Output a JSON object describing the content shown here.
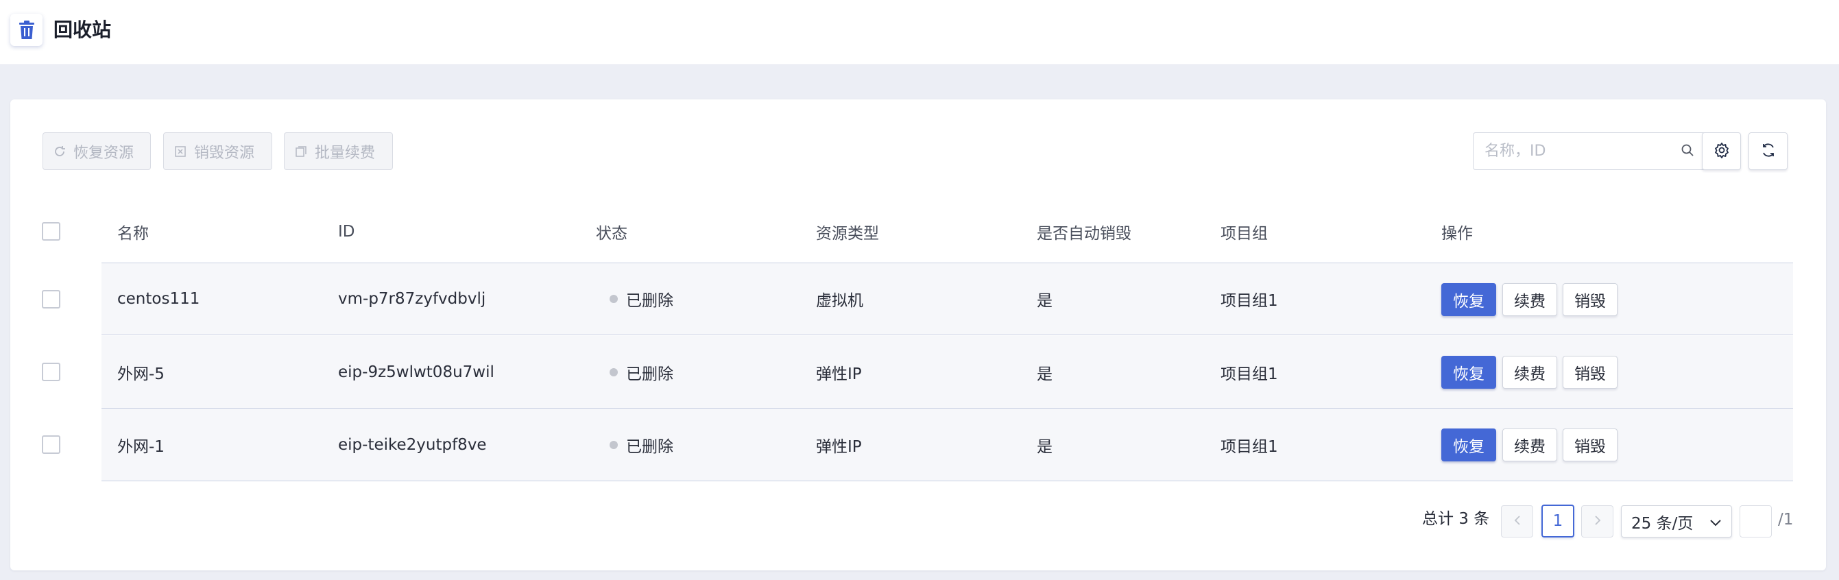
{
  "header": {
    "title": "回收站",
    "icon": "trash-icon"
  },
  "toolbar": {
    "restore_label": "恢复资源",
    "destroy_label": "销毁资源",
    "renew_label": "批量续费",
    "search_placeholder": "名称，ID"
  },
  "table": {
    "columns": [
      "名称",
      "ID",
      "状态",
      "资源类型",
      "是否自动销毁",
      "项目组",
      "操作"
    ],
    "rows": [
      {
        "name": "centos111",
        "id": "vm-p7r87zyfvdbvlj",
        "status": "已删除",
        "type": "虚拟机",
        "auto_destroy": "是",
        "project": "项目组1"
      },
      {
        "name": "外网-5",
        "id": "eip-9z5wlwt08u7wil",
        "status": "已删除",
        "type": "弹性IP",
        "auto_destroy": "是",
        "project": "项目组1"
      },
      {
        "name": "外网-1",
        "id": "eip-teike2yutpf8ve",
        "status": "已删除",
        "type": "弹性IP",
        "auto_destroy": "是",
        "project": "项目组1"
      }
    ],
    "actions": {
      "restore": "恢复",
      "renew": "续费",
      "destroy": "销毁"
    }
  },
  "pagination": {
    "total_text": "总计 3 条",
    "current_page": "1",
    "page_size": "25 条/页",
    "total_pages": "/1"
  },
  "colors": {
    "primary": "#4468d6",
    "background": "#eceef5"
  }
}
